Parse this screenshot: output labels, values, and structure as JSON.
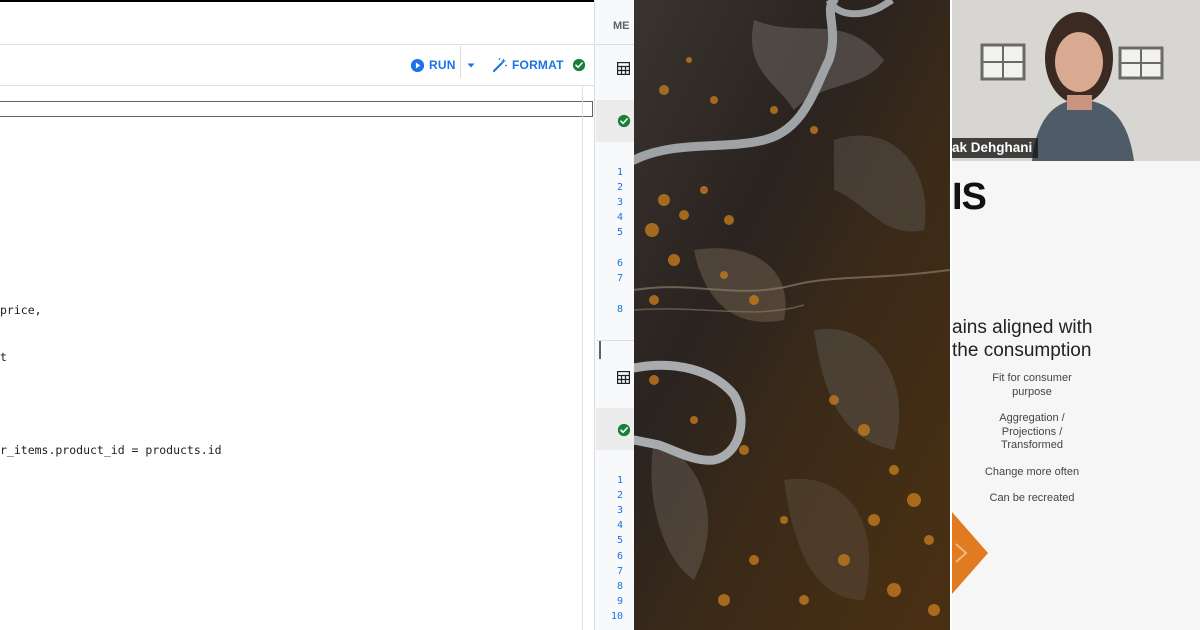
{
  "toolbar": {
    "run_label": "RUN",
    "format_label": "FORMAT",
    "run_icon": "play-circle-icon",
    "format_icon": "magic-wand-icon",
    "status_icon": "check-circle-icon",
    "accent_color": "#1a73e8",
    "success_color": "#188038"
  },
  "editor": {
    "code_lines": [
      "price,",
      "t",
      "",
      "r_items.product_id = products.id"
    ]
  },
  "queries_strip": {
    "header": "ME",
    "panels": [
      {
        "line_numbers": [
          "1",
          "2",
          "3",
          "4",
          "5",
          "6",
          "7",
          "8"
        ]
      },
      {
        "line_numbers": [
          "1",
          "2",
          "3",
          "4",
          "5",
          "6",
          "7",
          "8",
          "9",
          "10"
        ]
      }
    ]
  },
  "video_call": {
    "speaker_name": "ak Dehghani"
  },
  "slide": {
    "title_fragment": "IS",
    "heading": "ains aligned with\nthe consumption",
    "items": [
      "Fit for consumer purpose",
      "Aggregation / Projections / Transformed",
      "Change more often",
      "Can be recreated"
    ],
    "accent_color": "#e07b22"
  }
}
